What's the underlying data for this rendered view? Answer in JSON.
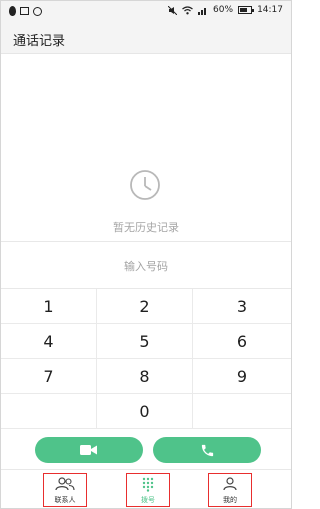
{
  "status_bar": {
    "battery": "60%",
    "time": "14:17"
  },
  "header": {
    "title": "通话记录"
  },
  "history": {
    "empty_text": "暂无历史记录"
  },
  "dialer": {
    "placeholder": "输入号码",
    "keys": [
      "1",
      "2",
      "3",
      "4",
      "5",
      "6",
      "7",
      "8",
      "9",
      "0"
    ]
  },
  "actions": {
    "video_icon": "video-camera-icon",
    "call_icon": "phone-icon"
  },
  "bottom_nav": {
    "items": [
      {
        "label": "联系人",
        "icon": "contacts-icon"
      },
      {
        "label": "拨号",
        "icon": "dialpad-icon"
      },
      {
        "label": "我的",
        "icon": "profile-icon"
      }
    ]
  },
  "colors": {
    "accent": "#4fc38a",
    "highlight_border": "#e82e2e",
    "muted_text": "#a6a6a6"
  }
}
